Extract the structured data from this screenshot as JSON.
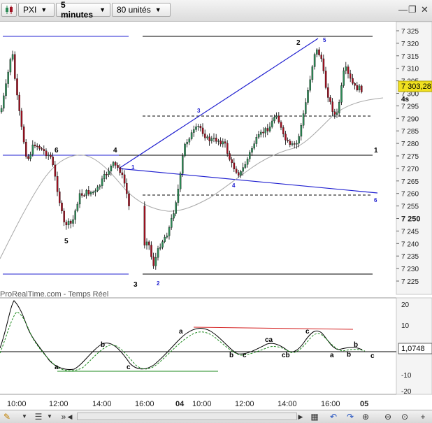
{
  "toolbar": {
    "symbol": "PXI",
    "timeframe": "5 minutes",
    "units": "80 unités"
  },
  "price_axis": {
    "ticks": [
      "7 325",
      "7 320",
      "7 315",
      "7 310",
      "7 305",
      "7 300",
      "7 295",
      "7 290",
      "7 285",
      "7 280",
      "7 275",
      "7 270",
      "7 265",
      "7 260",
      "7 255",
      "7 250",
      "7 245",
      "7 240",
      "7 235",
      "7 230",
      "7 225"
    ],
    "bold_tick": "7 250",
    "current_price": "7 303,28",
    "countdown": "4s"
  },
  "indicator_axis": {
    "ticks": [
      "20",
      "10",
      "0",
      "-10",
      "-20"
    ],
    "current_value": "1,0748"
  },
  "time_axis": {
    "labels": [
      "10:00",
      "12:00",
      "14:00",
      "16:00",
      "04",
      "10:00",
      "12:00",
      "14:00",
      "16:00",
      "05"
    ]
  },
  "source_label": "ProRealTime.com - Temps Réel",
  "price_annotations": {
    "black": [
      "6",
      "4",
      "5",
      "3",
      "2",
      "1"
    ],
    "blue": [
      "1",
      "2",
      "3",
      "4",
      "5",
      "6"
    ]
  },
  "indicator_annotations": [
    "a",
    "b",
    "c",
    "a",
    "b",
    "c",
    "ca",
    "cb",
    "c",
    "b",
    "a",
    "b",
    "c"
  ],
  "colors": {
    "up_candle": "#2e8b57",
    "down_candle": "#a01020",
    "trendline": "#2020d0",
    "resistance": "#d42020",
    "support": "#1e8a1e",
    "price_badge": "#f0e020"
  },
  "icons": [
    "pencil-icon",
    "dropdown-icon",
    "menu-icon",
    "scroll-left-icon",
    "scroll-right-icon",
    "undo-icon",
    "redo-icon",
    "zoom-in-icon",
    "zoom-out-icon",
    "cursor-icon",
    "plus-icon"
  ]
}
